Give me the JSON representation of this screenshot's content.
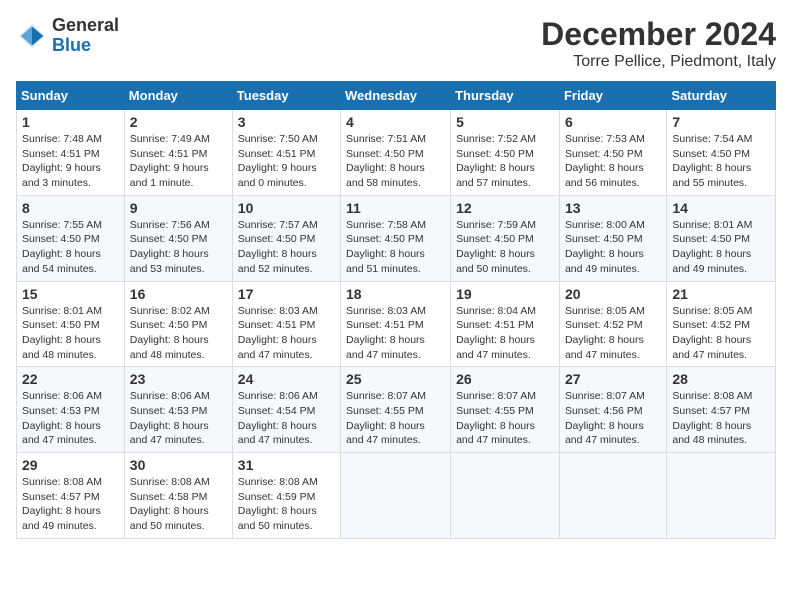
{
  "logo": {
    "general": "General",
    "blue": "Blue"
  },
  "title": "December 2024",
  "location": "Torre Pellice, Piedmont, Italy",
  "headers": [
    "Sunday",
    "Monday",
    "Tuesday",
    "Wednesday",
    "Thursday",
    "Friday",
    "Saturday"
  ],
  "weeks": [
    [
      {
        "day": "1",
        "sunrise": "7:48 AM",
        "sunset": "4:51 PM",
        "daylight": "9 hours and 3 minutes."
      },
      {
        "day": "2",
        "sunrise": "7:49 AM",
        "sunset": "4:51 PM",
        "daylight": "9 hours and 1 minute."
      },
      {
        "day": "3",
        "sunrise": "7:50 AM",
        "sunset": "4:51 PM",
        "daylight": "9 hours and 0 minutes."
      },
      {
        "day": "4",
        "sunrise": "7:51 AM",
        "sunset": "4:50 PM",
        "daylight": "8 hours and 58 minutes."
      },
      {
        "day": "5",
        "sunrise": "7:52 AM",
        "sunset": "4:50 PM",
        "daylight": "8 hours and 57 minutes."
      },
      {
        "day": "6",
        "sunrise": "7:53 AM",
        "sunset": "4:50 PM",
        "daylight": "8 hours and 56 minutes."
      },
      {
        "day": "7",
        "sunrise": "7:54 AM",
        "sunset": "4:50 PM",
        "daylight": "8 hours and 55 minutes."
      }
    ],
    [
      {
        "day": "8",
        "sunrise": "7:55 AM",
        "sunset": "4:50 PM",
        "daylight": "8 hours and 54 minutes."
      },
      {
        "day": "9",
        "sunrise": "7:56 AM",
        "sunset": "4:50 PM",
        "daylight": "8 hours and 53 minutes."
      },
      {
        "day": "10",
        "sunrise": "7:57 AM",
        "sunset": "4:50 PM",
        "daylight": "8 hours and 52 minutes."
      },
      {
        "day": "11",
        "sunrise": "7:58 AM",
        "sunset": "4:50 PM",
        "daylight": "8 hours and 51 minutes."
      },
      {
        "day": "12",
        "sunrise": "7:59 AM",
        "sunset": "4:50 PM",
        "daylight": "8 hours and 50 minutes."
      },
      {
        "day": "13",
        "sunrise": "8:00 AM",
        "sunset": "4:50 PM",
        "daylight": "8 hours and 49 minutes."
      },
      {
        "day": "14",
        "sunrise": "8:01 AM",
        "sunset": "4:50 PM",
        "daylight": "8 hours and 49 minutes."
      }
    ],
    [
      {
        "day": "15",
        "sunrise": "8:01 AM",
        "sunset": "4:50 PM",
        "daylight": "8 hours and 48 minutes."
      },
      {
        "day": "16",
        "sunrise": "8:02 AM",
        "sunset": "4:50 PM",
        "daylight": "8 hours and 48 minutes."
      },
      {
        "day": "17",
        "sunrise": "8:03 AM",
        "sunset": "4:51 PM",
        "daylight": "8 hours and 47 minutes."
      },
      {
        "day": "18",
        "sunrise": "8:03 AM",
        "sunset": "4:51 PM",
        "daylight": "8 hours and 47 minutes."
      },
      {
        "day": "19",
        "sunrise": "8:04 AM",
        "sunset": "4:51 PM",
        "daylight": "8 hours and 47 minutes."
      },
      {
        "day": "20",
        "sunrise": "8:05 AM",
        "sunset": "4:52 PM",
        "daylight": "8 hours and 47 minutes."
      },
      {
        "day": "21",
        "sunrise": "8:05 AM",
        "sunset": "4:52 PM",
        "daylight": "8 hours and 47 minutes."
      }
    ],
    [
      {
        "day": "22",
        "sunrise": "8:06 AM",
        "sunset": "4:53 PM",
        "daylight": "8 hours and 47 minutes."
      },
      {
        "day": "23",
        "sunrise": "8:06 AM",
        "sunset": "4:53 PM",
        "daylight": "8 hours and 47 minutes."
      },
      {
        "day": "24",
        "sunrise": "8:06 AM",
        "sunset": "4:54 PM",
        "daylight": "8 hours and 47 minutes."
      },
      {
        "day": "25",
        "sunrise": "8:07 AM",
        "sunset": "4:55 PM",
        "daylight": "8 hours and 47 minutes."
      },
      {
        "day": "26",
        "sunrise": "8:07 AM",
        "sunset": "4:55 PM",
        "daylight": "8 hours and 47 minutes."
      },
      {
        "day": "27",
        "sunrise": "8:07 AM",
        "sunset": "4:56 PM",
        "daylight": "8 hours and 47 minutes."
      },
      {
        "day": "28",
        "sunrise": "8:08 AM",
        "sunset": "4:57 PM",
        "daylight": "8 hours and 48 minutes."
      }
    ],
    [
      {
        "day": "29",
        "sunrise": "8:08 AM",
        "sunset": "4:57 PM",
        "daylight": "8 hours and 49 minutes."
      },
      {
        "day": "30",
        "sunrise": "8:08 AM",
        "sunset": "4:58 PM",
        "daylight": "8 hours and 50 minutes."
      },
      {
        "day": "31",
        "sunrise": "8:08 AM",
        "sunset": "4:59 PM",
        "daylight": "8 hours and 50 minutes."
      },
      null,
      null,
      null,
      null
    ]
  ]
}
